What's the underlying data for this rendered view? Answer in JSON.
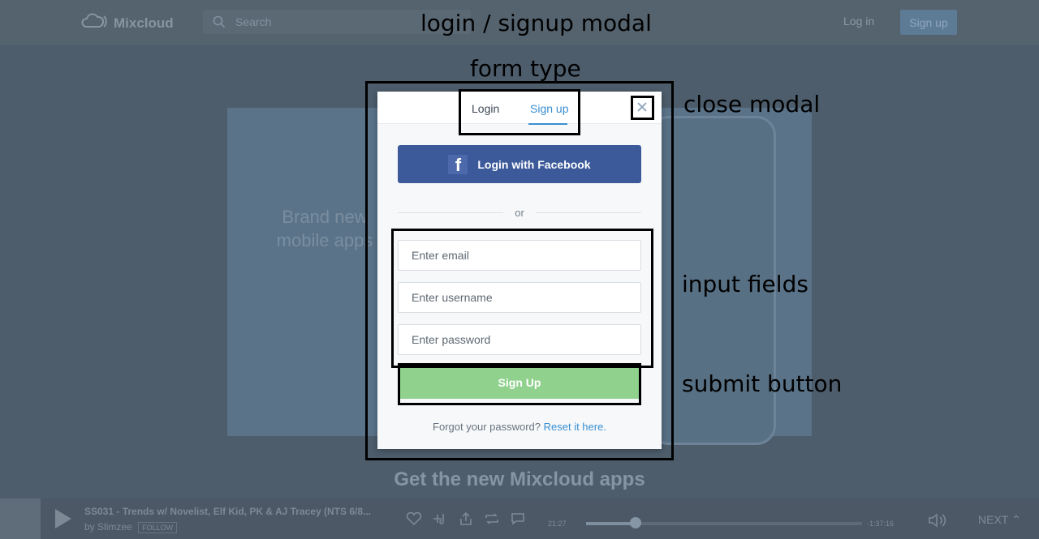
{
  "header": {
    "brand": "Mixcloud",
    "search_placeholder": "Search",
    "login_label": "Log in",
    "signup_label": "Sign up"
  },
  "hero": {
    "promo_text": "Brand new mobile apps",
    "title": "Get the new Mixcloud apps"
  },
  "player": {
    "track_title": "SS031 - Trends w/ Novelist, Elf Kid, PK & AJ Tracey (NTS 6/8...",
    "by_prefix": "by",
    "artist": "Slimzee",
    "follow_label": "FOLLOW",
    "current_time": "21:27",
    "remaining_time": "-1:37:16",
    "progress": 0.18,
    "next_label": "NEXT"
  },
  "modal": {
    "tabs": [
      {
        "label": "Login",
        "active": false
      },
      {
        "label": "Sign up",
        "active": true
      }
    ],
    "close_icon": "close-x",
    "facebook_label": "Login with Facebook",
    "facebook_icon": "f",
    "or_text": "or",
    "fields": {
      "email_placeholder": "Enter email",
      "username_placeholder": "Enter username",
      "password_placeholder": "Enter password"
    },
    "submit_label": "Sign Up",
    "forgot_text": "Forgot your password?",
    "reset_link": "Reset it here."
  },
  "annotations": {
    "title": "login / signup modal",
    "form_type": "form type",
    "close_modal": "close modal",
    "input_fields": "input fields",
    "submit_button": "submit button"
  },
  "colors": {
    "facebook": "#3c5a9a",
    "submit": "#90d18e",
    "accent": "#3a8fd1",
    "overlay_bg": "#4d5d6c"
  }
}
